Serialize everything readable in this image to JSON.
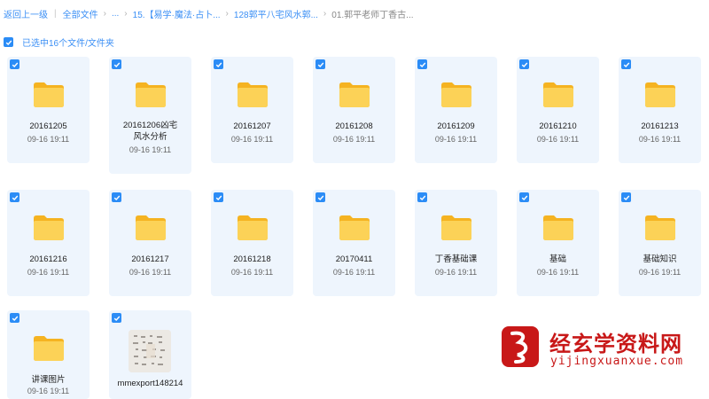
{
  "breadcrumb": {
    "back": "返回上一级",
    "all_files": "全部文件",
    "ellipsis": "...",
    "level1": "15.【易学·魔法·占卜...",
    "level2": "128郭平八宅风水郭...",
    "current": "01.郭平老师丁香古..."
  },
  "selection": {
    "summary": "已选中16个文件/文件夹"
  },
  "items": [
    {
      "name": "20161205",
      "date": "09-16 19:11",
      "type": "folder"
    },
    {
      "name": "20161206凶宅风水分析",
      "date": "09-16 19:11",
      "type": "folder"
    },
    {
      "name": "20161207",
      "date": "09-16 19:11",
      "type": "folder"
    },
    {
      "name": "20161208",
      "date": "09-16 19:11",
      "type": "folder"
    },
    {
      "name": "20161209",
      "date": "09-16 19:11",
      "type": "folder"
    },
    {
      "name": "20161210",
      "date": "09-16 19:11",
      "type": "folder"
    },
    {
      "name": "20161213",
      "date": "09-16 19:11",
      "type": "folder"
    },
    {
      "name": "20161216",
      "date": "09-16 19:11",
      "type": "folder"
    },
    {
      "name": "20161217",
      "date": "09-16 19:11",
      "type": "folder"
    },
    {
      "name": "20161218",
      "date": "09-16 19:11",
      "type": "folder"
    },
    {
      "name": "20170411",
      "date": "09-16 19:11",
      "type": "folder"
    },
    {
      "name": "丁香基础课",
      "date": "09-16 19:11",
      "type": "folder"
    },
    {
      "name": "基础",
      "date": "09-16 19:11",
      "type": "folder"
    },
    {
      "name": "基础知识",
      "date": "09-16 19:11",
      "type": "folder"
    },
    {
      "name": "讲课图片",
      "date": "09-16 19:11",
      "type": "folder"
    },
    {
      "name": "mmexport148214",
      "date": "",
      "type": "image"
    }
  ],
  "watermark": {
    "name": "经玄学资料网",
    "url": "yijingxuanxue.com"
  },
  "colors": {
    "accent": "#2b8cf6",
    "tile_bg": "#eef5fd",
    "folder": "#f9c53a",
    "watermark": "#c81818"
  }
}
